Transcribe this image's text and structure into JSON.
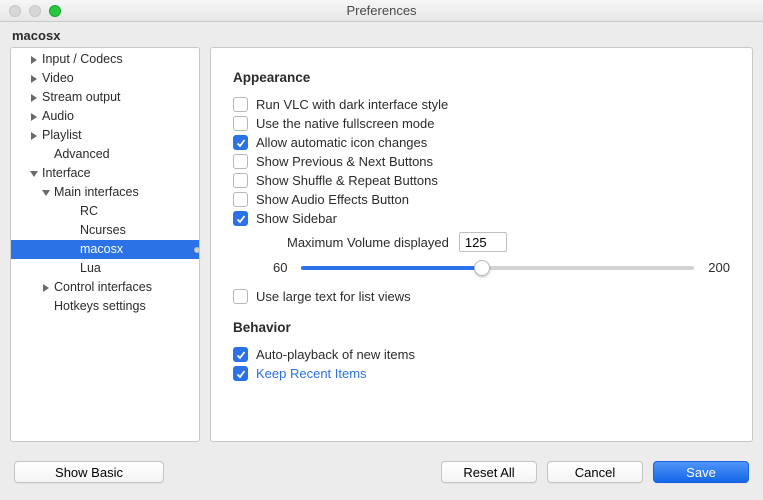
{
  "window": {
    "title": "Preferences"
  },
  "section": "macosx",
  "sidebar": {
    "items": [
      {
        "label": "Input / Codecs",
        "indent": 18,
        "arrow": "right"
      },
      {
        "label": "Video",
        "indent": 18,
        "arrow": "right"
      },
      {
        "label": "Stream output",
        "indent": 18,
        "arrow": "right"
      },
      {
        "label": "Audio",
        "indent": 18,
        "arrow": "right"
      },
      {
        "label": "Playlist",
        "indent": 18,
        "arrow": "right"
      },
      {
        "label": "Advanced",
        "indent": 30,
        "arrow": "none"
      },
      {
        "label": "Interface",
        "indent": 18,
        "arrow": "down"
      },
      {
        "label": "Main interfaces",
        "indent": 30,
        "arrow": "down"
      },
      {
        "label": "RC",
        "indent": 56,
        "arrow": "none"
      },
      {
        "label": "Ncurses",
        "indent": 56,
        "arrow": "none"
      },
      {
        "label": "macosx",
        "indent": 56,
        "arrow": "none",
        "selected": true
      },
      {
        "label": "Lua",
        "indent": 56,
        "arrow": "none"
      },
      {
        "label": "Control interfaces",
        "indent": 30,
        "arrow": "right"
      },
      {
        "label": "Hotkeys settings",
        "indent": 30,
        "arrow": "none"
      }
    ]
  },
  "content": {
    "appearance": {
      "title": "Appearance",
      "dark_interface": {
        "label": "Run VLC with dark interface style",
        "checked": false
      },
      "native_fullscreen": {
        "label": "Use the native fullscreen mode",
        "checked": false
      },
      "auto_icon": {
        "label": "Allow automatic icon changes",
        "checked": true
      },
      "prev_next": {
        "label": "Show Previous & Next Buttons",
        "checked": false
      },
      "shuffle_repeat": {
        "label": "Show Shuffle & Repeat Buttons",
        "checked": false
      },
      "audio_effects": {
        "label": "Show Audio Effects Button",
        "checked": false
      },
      "sidebar": {
        "label": "Show Sidebar",
        "checked": true
      },
      "max_volume_label": "Maximum Volume displayed",
      "max_volume_value": "125",
      "slider": {
        "min": "60",
        "max": "200",
        "value": 125,
        "percent": 46
      },
      "large_text": {
        "label": "Use large text for list views",
        "checked": false
      }
    },
    "behavior": {
      "title": "Behavior",
      "auto_playback": {
        "label": "Auto-playback of new items",
        "checked": true
      },
      "keep_recent": {
        "label": "Keep Recent Items",
        "checked": true
      }
    }
  },
  "buttons": {
    "show_basic": "Show Basic",
    "reset_all": "Reset All",
    "cancel": "Cancel",
    "save": "Save"
  }
}
